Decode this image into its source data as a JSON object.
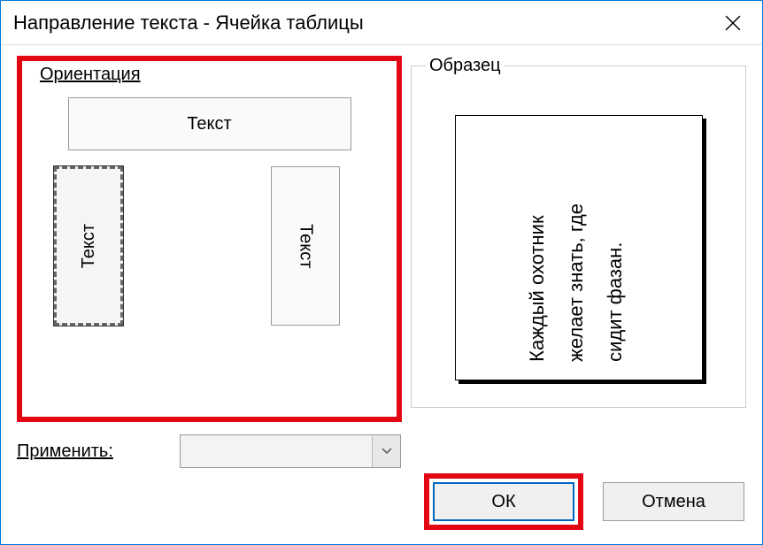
{
  "titlebar": {
    "title": "Направление текста - Ячейка таблицы"
  },
  "orientation": {
    "legend": "Ориентация",
    "horizontal_label": "Текст",
    "vertical_up_label": "Текст",
    "vertical_down_label": "Текст"
  },
  "preview": {
    "legend": "Образец",
    "text": "Каждый охотник\nжелает знать, где\nсидит фазан."
  },
  "apply": {
    "label": "Применить:",
    "value": ""
  },
  "buttons": {
    "ok": "ОК",
    "cancel": "Отмена"
  }
}
